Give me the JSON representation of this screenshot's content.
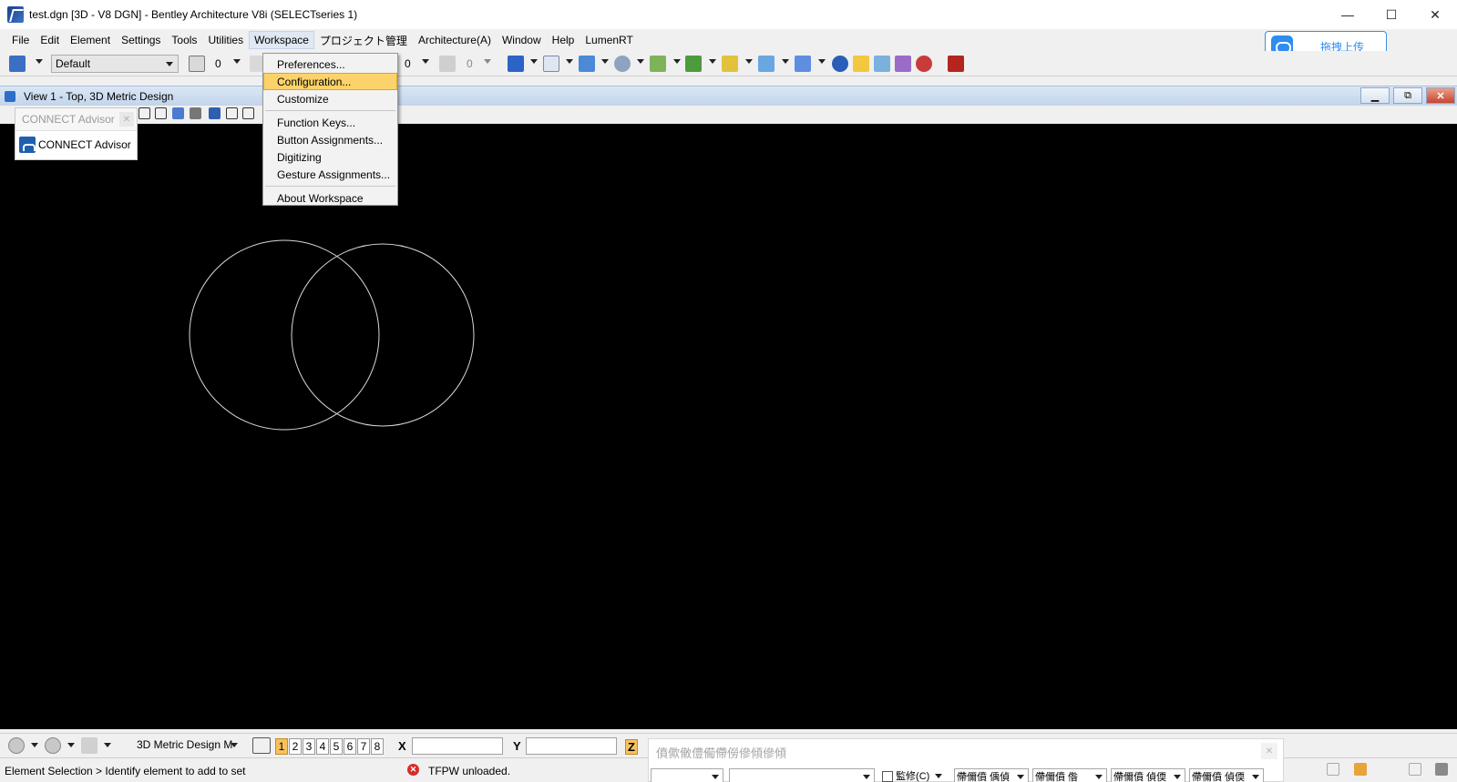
{
  "window": {
    "title": "test.dgn [3D - V8 DGN] - Bentley Architecture V8i (SELECTseries 1)",
    "minimize": "—",
    "maximize": "☐",
    "close": "✕"
  },
  "menu": [
    "File",
    "Edit",
    "Element",
    "Settings",
    "Tools",
    "Utilities",
    "Workspace",
    "プロジェクト管理",
    "Architecture(A)",
    "Window",
    "Help",
    "LumenRT"
  ],
  "upload_button": {
    "label": "拖拽上传"
  },
  "toolbar": {
    "level_combo": "Default",
    "num_a": "0",
    "num_b": "0",
    "num_c": "0"
  },
  "workspace_menu": {
    "items_group1": [
      "Preferences...",
      "Configuration...",
      "Customize"
    ],
    "items_group2": [
      "Function Keys...",
      "Button Assignments...",
      "Digitizing",
      "Gesture Assignments..."
    ],
    "items_group3": [
      "About Workspace"
    ],
    "highlighted": "Configuration..."
  },
  "view": {
    "title": "View 1 - Top, 3D Metric Design",
    "restore": "⧉",
    "close": "✕"
  },
  "advisor": {
    "header": "CONNECT Advisor",
    "close": "✕",
    "item": "CONNECT Advisor"
  },
  "bottom": {
    "model_combo": "3D Metric Design M",
    "view_numbers": [
      "1",
      "2",
      "3",
      "4",
      "5",
      "6",
      "7",
      "8"
    ],
    "selected_view": "1",
    "x_label": "X",
    "y_label": "Y",
    "z_label": "Z"
  },
  "status": {
    "left": "Element Selection > Identify element to add to set",
    "message": "TFPW unloaded."
  },
  "float_panel": {
    "title": "僨僛僌僼僃僀僗傪傾傪傾",
    "checkbox_label": "監修(C)",
    "combos": [
      "",
      "",
      "僀儞僨 偊偵",
      "僀儞僨 偺",
      "僀儞僨 偵偄",
      "僀儞僨 偵偄"
    ]
  },
  "colors": {
    "accent": "#fcd36a",
    "canvas": "#000000",
    "upload": "#2f8cf0"
  }
}
